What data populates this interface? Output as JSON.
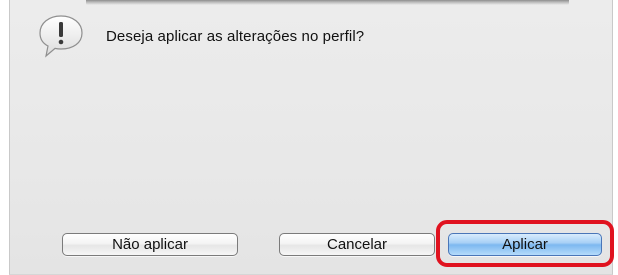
{
  "dialog": {
    "message": "Deseja aplicar as alterações no perfil?",
    "icon": "alert-speech-bubble-icon"
  },
  "buttons": {
    "dont_apply_label": "Não aplicar",
    "cancel_label": "Cancelar",
    "apply_label": "Aplicar"
  },
  "colors": {
    "highlight_ring": "#e0121f",
    "default_button": "#7db8f0"
  }
}
